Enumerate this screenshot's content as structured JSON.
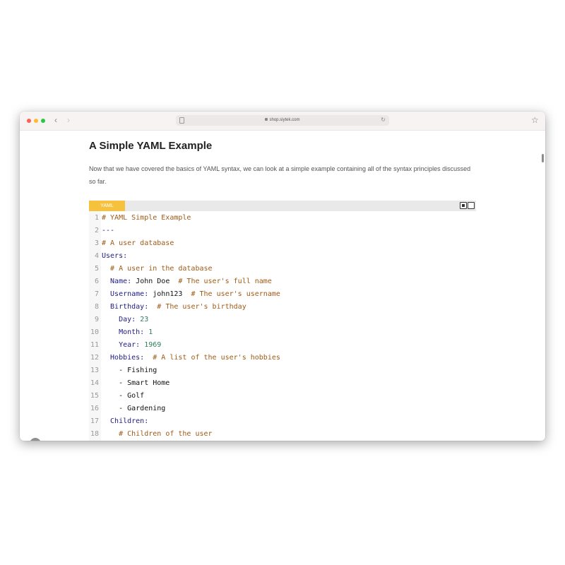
{
  "browser": {
    "url": "shop.siytek.com",
    "back_icon": "‹",
    "forward_icon": "›",
    "reload_icon": "↻",
    "bookmark_icon": "☆",
    "icons": [
      "back-chevron-icon",
      "forward-chevron-icon",
      "tab-overview-icon",
      "lock-icon",
      "reload-icon",
      "bookmark-star-icon"
    ]
  },
  "article": {
    "heading": "A Simple YAML Example",
    "intro": "Now that we have covered the basics of YAML syntax, we can look at a simple example containing all of the syntax principles discussed so far."
  },
  "code": {
    "language": "YAML",
    "lines": [
      {
        "no": "1",
        "parts": [
          {
            "t": "# YAML Simple Example",
            "c": "c"
          }
        ]
      },
      {
        "no": "2",
        "parts": [
          {
            "t": "---",
            "c": "k"
          }
        ]
      },
      {
        "no": "3",
        "parts": [
          {
            "t": "# A user database",
            "c": "c"
          }
        ]
      },
      {
        "no": "4",
        "parts": [
          {
            "t": "Users:",
            "c": "k"
          }
        ]
      },
      {
        "no": "5",
        "parts": [
          {
            "t": "  ",
            "c": "v"
          },
          {
            "t": "# A user in the database",
            "c": "c"
          }
        ]
      },
      {
        "no": "6",
        "parts": [
          {
            "t": "  Name:",
            "c": "k"
          },
          {
            "t": " John Doe  ",
            "c": "v"
          },
          {
            "t": "# The user's full name",
            "c": "c"
          }
        ]
      },
      {
        "no": "7",
        "parts": [
          {
            "t": "  Username:",
            "c": "k"
          },
          {
            "t": " john123  ",
            "c": "v"
          },
          {
            "t": "# The user's username",
            "c": "c"
          }
        ]
      },
      {
        "no": "8",
        "parts": [
          {
            "t": "  Birthday:",
            "c": "k"
          },
          {
            "t": "  ",
            "c": "v"
          },
          {
            "t": "# The user's birthday",
            "c": "c"
          }
        ]
      },
      {
        "no": "9",
        "parts": [
          {
            "t": "    Day:",
            "c": "k"
          },
          {
            "t": " 23",
            "c": "n"
          }
        ]
      },
      {
        "no": "10",
        "parts": [
          {
            "t": "    Month:",
            "c": "k"
          },
          {
            "t": " 1",
            "c": "n"
          }
        ]
      },
      {
        "no": "11",
        "parts": [
          {
            "t": "    Year:",
            "c": "k"
          },
          {
            "t": " 1969",
            "c": "n"
          }
        ]
      },
      {
        "no": "12",
        "parts": [
          {
            "t": "  Hobbies:",
            "c": "k"
          },
          {
            "t": "  ",
            "c": "v"
          },
          {
            "t": "# A list of the user's hobbies",
            "c": "c"
          }
        ]
      },
      {
        "no": "13",
        "parts": [
          {
            "t": "    - Fishing",
            "c": "v"
          }
        ]
      },
      {
        "no": "14",
        "parts": [
          {
            "t": "    - Smart Home",
            "c": "v"
          }
        ]
      },
      {
        "no": "15",
        "parts": [
          {
            "t": "    - Golf",
            "c": "v"
          }
        ]
      },
      {
        "no": "16",
        "parts": [
          {
            "t": "    - Gardening",
            "c": "v"
          }
        ]
      },
      {
        "no": "17",
        "parts": [
          {
            "t": "  Children:",
            "c": "k"
          }
        ]
      },
      {
        "no": "18",
        "parts": [
          {
            "t": "    ",
            "c": "v"
          },
          {
            "t": "# Children of the user",
            "c": "c"
          }
        ]
      }
    ]
  },
  "ui": {
    "scroll_top_icon": "⌃"
  }
}
